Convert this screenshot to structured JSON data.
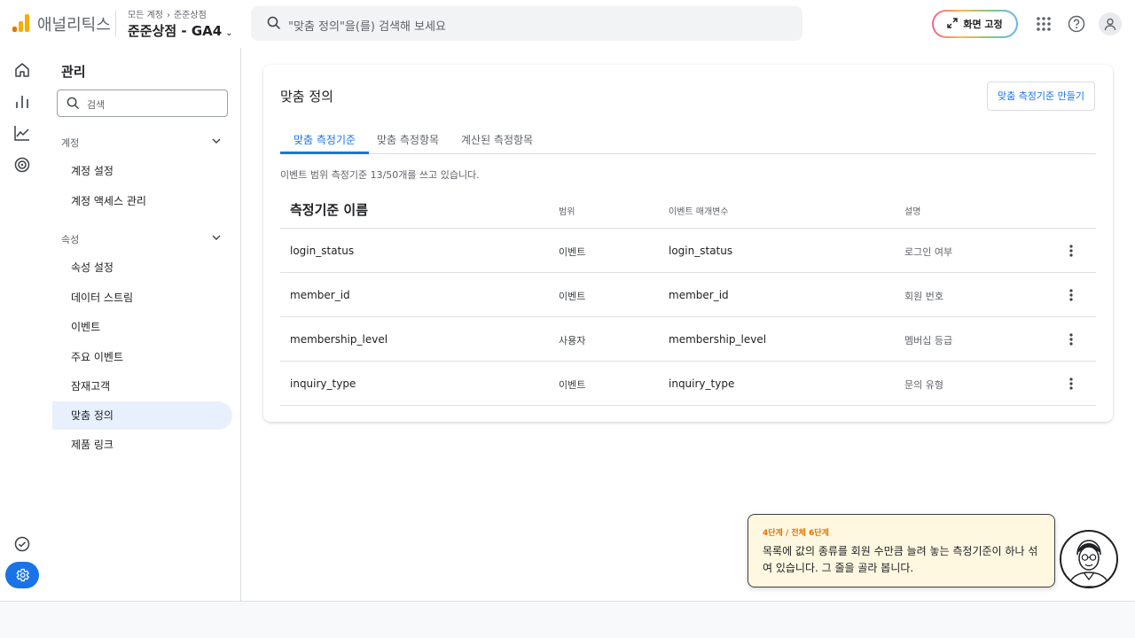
{
  "app": {
    "name": "애널리틱스",
    "brand_colors": [
      "#f9ab00",
      "#e37400"
    ]
  },
  "breadcrumb": {
    "account": "모든 계정",
    "separator": "›",
    "property_crumb": "준준상점"
  },
  "property": {
    "name": "준준상점 - GA4",
    "chevron": "⌄"
  },
  "search": {
    "placeholder": "\"맞춤 정의\"을(를) 검색해 보세요"
  },
  "header": {
    "pin_label": "화면 고정",
    "icons": [
      "apps-grid-icon",
      "help-icon",
      "account-icon"
    ]
  },
  "rail": {
    "icons": [
      "home-icon",
      "reports-icon",
      "explore-icon",
      "advertising-icon",
      "check-icon",
      "settings-icon"
    ]
  },
  "nav": {
    "title": "관리",
    "search_placeholder": "검색",
    "sections": [
      {
        "label": "계정",
        "items": [
          "계정 설정",
          "계정 액세스 관리"
        ]
      },
      {
        "label": "속성",
        "items": [
          "속성 설정",
          "데이터 스트림",
          "이벤트",
          "주요 이벤트",
          "잠재고객",
          "맞춤 정의",
          "제품 링크"
        ]
      }
    ],
    "active_item": "맞춤 정의"
  },
  "main": {
    "title": "맞춤 정의",
    "create_button": "맞춤 측정기준 만들기",
    "tabs": [
      {
        "label": "맞춤 측정기준",
        "active": true
      },
      {
        "label": "맞춤 측정항목",
        "active": false
      },
      {
        "label": "계산된 측정항목",
        "active": false
      }
    ],
    "usage_text": "이벤트 범위 측정기준 13/50개를 쓰고 있습니다.",
    "columns": {
      "name": "측정기준 이름",
      "scope": "범위",
      "param": "이벤트 매개변수",
      "desc": "설명"
    },
    "rows": [
      {
        "name": "login_status",
        "scope": "이벤트",
        "param": "login_status",
        "desc": "로그인 여부"
      },
      {
        "name": "member_id",
        "scope": "이벤트",
        "param": "member_id",
        "desc": "회원 번호"
      },
      {
        "name": "membership_level",
        "scope": "사용자",
        "param": "membership_level",
        "desc": "멤버십 등급"
      },
      {
        "name": "inquiry_type",
        "scope": "이벤트",
        "param": "inquiry_type",
        "desc": "문의 유형"
      }
    ]
  },
  "tutorial": {
    "step": "4단계 / 전체 6단계",
    "message": "목록에 값의 종류를 회원 수만큼 늘려 놓는 측정기준이 하나 섞여 있습니다. 그 줄을 골라 봅니다."
  },
  "colors": {
    "accent": "#1a73e8",
    "active_nav_bg": "#e8f0fe",
    "tip_bg": "#fff8e1",
    "step_color": "#e37400"
  }
}
